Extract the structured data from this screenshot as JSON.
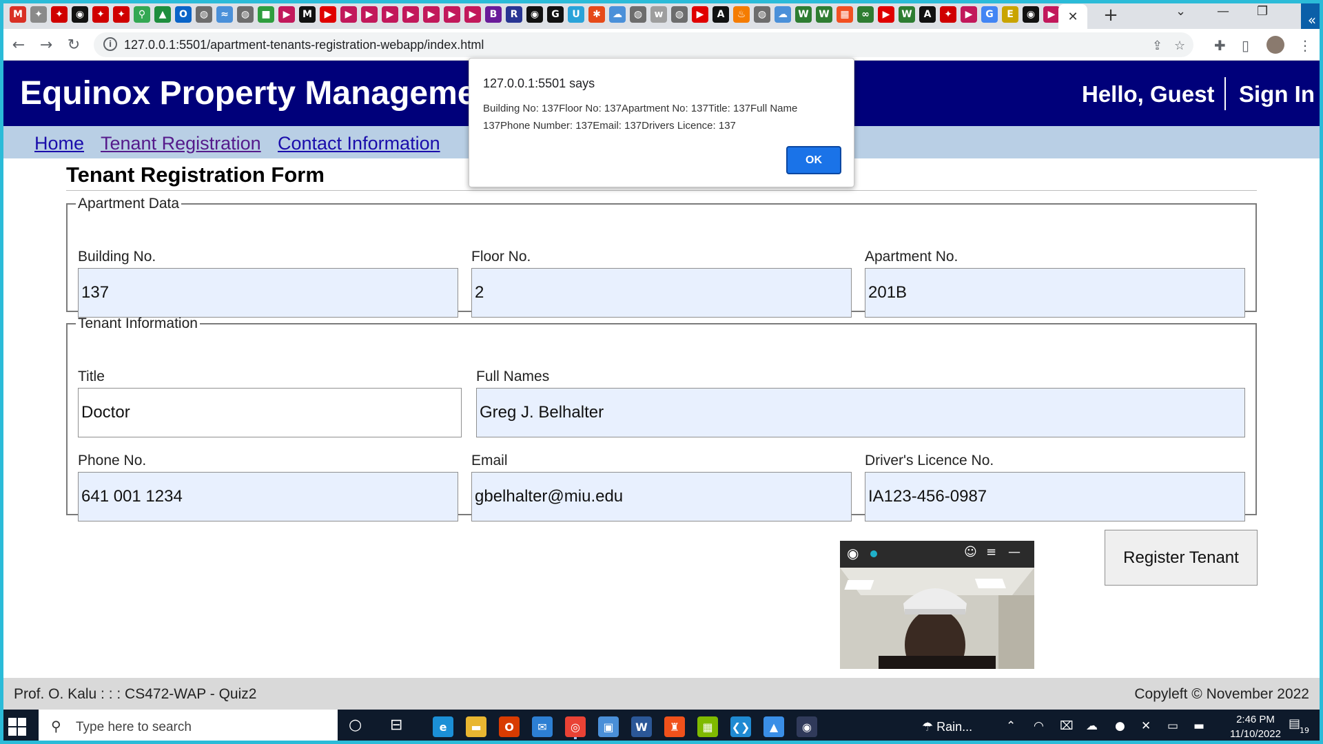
{
  "browser": {
    "favicons": [
      {
        "name": "gmail-icon",
        "glyph": "M",
        "color": "#d93025"
      },
      {
        "name": "maple-leaf-icon",
        "glyph": "✦",
        "color": "#8a8a8a"
      },
      {
        "name": "maple-leaf-icon",
        "glyph": "✦",
        "color": "#d00000"
      },
      {
        "name": "github-icon",
        "glyph": "◉",
        "color": "#111111"
      },
      {
        "name": "maple-leaf-icon",
        "glyph": "✦",
        "color": "#d00000"
      },
      {
        "name": "maple-leaf-icon",
        "glyph": "✦",
        "color": "#d00000"
      },
      {
        "name": "maps-pin-icon",
        "glyph": "⚲",
        "color": "#34a853"
      },
      {
        "name": "drive-icon",
        "glyph": "▲",
        "color": "#1e8e3e"
      },
      {
        "name": "outlook-icon",
        "glyph": "O",
        "color": "#0a64c8"
      },
      {
        "name": "globe-icon",
        "glyph": "◍",
        "color": "#6d6d6d"
      },
      {
        "name": "boat-icon",
        "glyph": "≈",
        "color": "#4a90d9"
      },
      {
        "name": "globe-icon",
        "glyph": "◍",
        "color": "#6d6d6d"
      },
      {
        "name": "green-square-icon",
        "glyph": "■",
        "color": "#2e9e3e"
      },
      {
        "name": "play-icon",
        "glyph": "▶",
        "color": "#c2185b"
      },
      {
        "name": "medium-icon",
        "glyph": "M",
        "color": "#111111"
      },
      {
        "name": "youtube-icon",
        "glyph": "▶",
        "color": "#e00000"
      },
      {
        "name": "play-icon",
        "glyph": "▶",
        "color": "#c2185b"
      },
      {
        "name": "play-icon",
        "glyph": "▶",
        "color": "#c2185b"
      },
      {
        "name": "play-icon",
        "glyph": "▶",
        "color": "#c2185b"
      },
      {
        "name": "play-icon",
        "glyph": "▶",
        "color": "#c2185b"
      },
      {
        "name": "play-icon",
        "glyph": "▶",
        "color": "#c2185b"
      },
      {
        "name": "play-icon",
        "glyph": "▶",
        "color": "#c2185b"
      },
      {
        "name": "play-icon",
        "glyph": "▶",
        "color": "#c2185b"
      },
      {
        "name": "b-badge-icon",
        "glyph": "B",
        "color": "#6a1b9a"
      },
      {
        "name": "r-badge-icon",
        "glyph": "R",
        "color": "#283593"
      },
      {
        "name": "github-icon",
        "glyph": "◉",
        "color": "#111111"
      },
      {
        "name": "g-square-icon",
        "glyph": "G",
        "color": "#111111"
      },
      {
        "name": "u-badge-icon",
        "glyph": "U",
        "color": "#29a3d9"
      },
      {
        "name": "asterisk-icon",
        "glyph": "✱",
        "color": "#e64a19"
      },
      {
        "name": "cloud-icon",
        "glyph": "☁",
        "color": "#4a90d9"
      },
      {
        "name": "globe-icon",
        "glyph": "◍",
        "color": "#6d6d6d"
      },
      {
        "name": "w3schools-icon",
        "glyph": "w",
        "color": "#9e9e9e"
      },
      {
        "name": "globe-icon",
        "glyph": "◍",
        "color": "#6d6d6d"
      },
      {
        "name": "youtube-icon",
        "glyph": "▶",
        "color": "#e00000"
      },
      {
        "name": "angular-icon",
        "glyph": "A",
        "color": "#111111"
      },
      {
        "name": "fire-icon",
        "glyph": "♨",
        "color": "#f57c00"
      },
      {
        "name": "globe-icon",
        "glyph": "◍",
        "color": "#6d6d6d"
      },
      {
        "name": "cloud-icon",
        "glyph": "☁",
        "color": "#4a90d9"
      },
      {
        "name": "w-icon",
        "glyph": "W",
        "color": "#2e7d32"
      },
      {
        "name": "w-icon",
        "glyph": "W",
        "color": "#2e7d32"
      },
      {
        "name": "microsoft-icon",
        "glyph": "▦",
        "color": "#f25022"
      },
      {
        "name": "infinity-icon",
        "glyph": "∞",
        "color": "#2e7d32"
      },
      {
        "name": "youtube-icon",
        "glyph": "▶",
        "color": "#e00000"
      },
      {
        "name": "w-icon",
        "glyph": "W",
        "color": "#2e7d32"
      },
      {
        "name": "angular-icon",
        "glyph": "A",
        "color": "#111111"
      },
      {
        "name": "maple-leaf-icon",
        "glyph": "✦",
        "color": "#d00000"
      },
      {
        "name": "play-icon",
        "glyph": "▶",
        "color": "#c2185b"
      },
      {
        "name": "google-icon",
        "glyph": "G",
        "color": "#4285f4"
      },
      {
        "name": "ejs-icon",
        "glyph": "E",
        "color": "#c9a400"
      },
      {
        "name": "github-icon",
        "glyph": "◉",
        "color": "#111111"
      },
      {
        "name": "play-icon",
        "glyph": "▶",
        "color": "#c2185b"
      },
      {
        "name": "globe-icon",
        "glyph": "◍",
        "color": "#6d6d6d"
      }
    ],
    "active_tab_close": "✕",
    "new_tab": "+",
    "url": "127.0.0.1:5501/apartment-tenants-registration-webapp/index.html",
    "info_glyph": "i",
    "nav": {
      "back": "←",
      "forward": "→",
      "reload": "↻"
    },
    "icons": {
      "share": "⇪",
      "star": "☆",
      "extensions": "✚",
      "sidebar": "▯",
      "menu": "⋮"
    },
    "window": {
      "chevron": "⌄",
      "minimize": "—",
      "restore": "❐",
      "close": "✕",
      "side_panel": "«"
    }
  },
  "site": {
    "title": "Equinox Property Management Corporation",
    "greeting": "Hello, Guest",
    "sign_in": "Sign In",
    "nav": {
      "home": "Home",
      "tenant_registration": "Tenant Registration",
      "contact_information": "Contact Information"
    },
    "colors": {
      "header_bg": "#00007a",
      "nav_bg": "#b9cfe5"
    }
  },
  "form": {
    "title": "Tenant Registration Form",
    "apartment": {
      "legend": "Apartment Data",
      "building": {
        "label": "Building No.",
        "value": "137"
      },
      "floor": {
        "label": "Floor No.",
        "value": "2"
      },
      "apartment_no": {
        "label": "Apartment No.",
        "value": "201B"
      }
    },
    "tenant": {
      "legend": "Tenant Information",
      "title_field": {
        "label": "Title",
        "value": "Doctor"
      },
      "full_names": {
        "label": "Full Names",
        "value": "Greg J. Belhalter"
      },
      "phone": {
        "label": "Phone No.",
        "value": "641 001 1234"
      },
      "email": {
        "label": "Email",
        "value": "gbelhalter@miu.edu"
      },
      "licence": {
        "label": "Driver's Licence No.",
        "value": "IA123-456-0987"
      }
    },
    "register_button": "Register Tenant"
  },
  "footer": {
    "left": "Prof. O. Kalu : : : CS472-WAP - Quiz2",
    "right": "Copyleft © November 2022"
  },
  "alert": {
    "title": "127.0.0.1:5501 says",
    "message": "Building No: 137Floor No: 137Apartment No: 137Title: 137Full Name 137Phone Number: 137Email: 137Drivers Licence: 137",
    "ok": "OK"
  },
  "webcam": {
    "eye": "◉",
    "chat": "☺",
    "menu": "≡",
    "minimize": "—"
  },
  "taskbar": {
    "search_placeholder": "Type here to search",
    "search_glyph": "⚲",
    "task_view_glyph": "○",
    "widgets_glyph": "⊟",
    "apps": [
      {
        "name": "edge-icon",
        "glyph": "e",
        "color": "#1b8fd6"
      },
      {
        "name": "file-explorer-icon",
        "glyph": "▬",
        "color": "#e8b631"
      },
      {
        "name": "office-icon",
        "glyph": "O",
        "color": "#d83b01"
      },
      {
        "name": "mail-icon",
        "glyph": "✉",
        "color": "#2d7fd3"
      },
      {
        "name": "chrome-icon",
        "glyph": "◎",
        "color": "#e94235"
      },
      {
        "name": "remote-desktop-icon",
        "glyph": "▣",
        "color": "#4a8fd8"
      },
      {
        "name": "word-icon",
        "glyph": "W",
        "color": "#2b5797"
      },
      {
        "name": "brave-icon",
        "glyph": "♜",
        "color": "#f1511b"
      },
      {
        "name": "microsoft-store-icon",
        "glyph": "▦",
        "color": "#7fba00"
      },
      {
        "name": "vscode-icon",
        "glyph": "❮❯",
        "color": "#1f8ad2"
      },
      {
        "name": "photos-icon",
        "glyph": "▲",
        "color": "#3a8ee6"
      },
      {
        "name": "eye-app-icon",
        "glyph": "◉",
        "color": "#303a5a"
      }
    ],
    "weather": "Rain...",
    "tray": {
      "chevron": "⌃",
      "wifi": "◠",
      "camera": "⌧",
      "cloud": "☁",
      "mic": "●",
      "volume": "✕",
      "display": "▭",
      "battery": "▬"
    },
    "time": "2:46 PM",
    "date": "11/10/2022",
    "notifications": "19"
  }
}
